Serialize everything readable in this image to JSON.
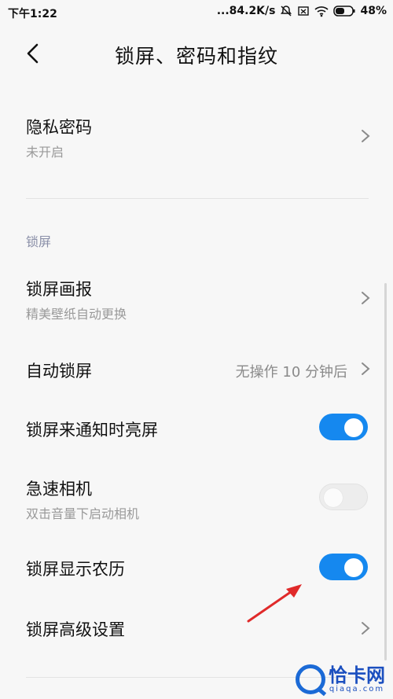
{
  "statusbar": {
    "time": "下午1:22",
    "net_speed": "...84.2K/s",
    "battery": "48%"
  },
  "header": {
    "title": "锁屏、密码和指纹"
  },
  "privacy": {
    "title": "隐私密码",
    "subtitle": "未开启"
  },
  "section_lockscreen": "锁屏",
  "items": [
    {
      "title": "锁屏画报",
      "subtitle": "精美壁纸自动更换"
    },
    {
      "title": "自动锁屏",
      "value": "无操作 10 分钟后"
    },
    {
      "title": "锁屏来通知时亮屏",
      "toggle": "on"
    },
    {
      "title": "急速相机",
      "subtitle": "双击音量下启动相机",
      "toggle": "off"
    },
    {
      "title": "锁屏显示农历",
      "toggle": "on"
    },
    {
      "title": "锁屏高级设置"
    }
  ],
  "watermark": {
    "name": "恰卡网",
    "url": "qiaqa.com"
  },
  "colors": {
    "accent": "#1588ef",
    "arrow": "#e02a2a"
  }
}
